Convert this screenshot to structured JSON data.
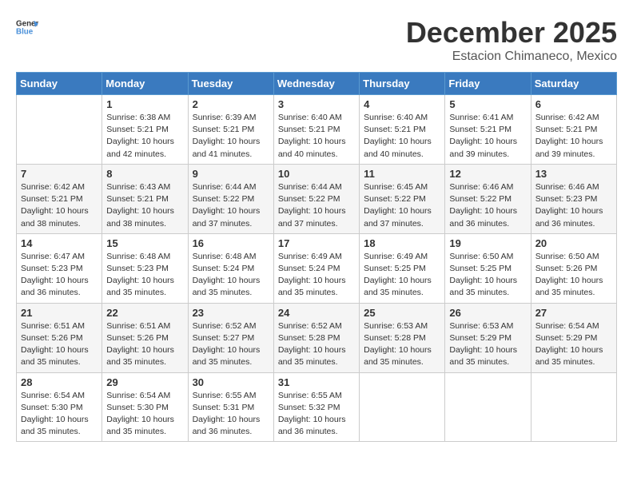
{
  "header": {
    "logo_general": "General",
    "logo_blue": "Blue",
    "month": "December 2025",
    "location": "Estacion Chimaneco, Mexico"
  },
  "weekdays": [
    "Sunday",
    "Monday",
    "Tuesday",
    "Wednesday",
    "Thursday",
    "Friday",
    "Saturday"
  ],
  "weeks": [
    [
      {
        "day": "",
        "info": ""
      },
      {
        "day": "1",
        "info": "Sunrise: 6:38 AM\nSunset: 5:21 PM\nDaylight: 10 hours\nand 42 minutes."
      },
      {
        "day": "2",
        "info": "Sunrise: 6:39 AM\nSunset: 5:21 PM\nDaylight: 10 hours\nand 41 minutes."
      },
      {
        "day": "3",
        "info": "Sunrise: 6:40 AM\nSunset: 5:21 PM\nDaylight: 10 hours\nand 40 minutes."
      },
      {
        "day": "4",
        "info": "Sunrise: 6:40 AM\nSunset: 5:21 PM\nDaylight: 10 hours\nand 40 minutes."
      },
      {
        "day": "5",
        "info": "Sunrise: 6:41 AM\nSunset: 5:21 PM\nDaylight: 10 hours\nand 39 minutes."
      },
      {
        "day": "6",
        "info": "Sunrise: 6:42 AM\nSunset: 5:21 PM\nDaylight: 10 hours\nand 39 minutes."
      }
    ],
    [
      {
        "day": "7",
        "info": "Sunrise: 6:42 AM\nSunset: 5:21 PM\nDaylight: 10 hours\nand 38 minutes."
      },
      {
        "day": "8",
        "info": "Sunrise: 6:43 AM\nSunset: 5:21 PM\nDaylight: 10 hours\nand 38 minutes."
      },
      {
        "day": "9",
        "info": "Sunrise: 6:44 AM\nSunset: 5:22 PM\nDaylight: 10 hours\nand 37 minutes."
      },
      {
        "day": "10",
        "info": "Sunrise: 6:44 AM\nSunset: 5:22 PM\nDaylight: 10 hours\nand 37 minutes."
      },
      {
        "day": "11",
        "info": "Sunrise: 6:45 AM\nSunset: 5:22 PM\nDaylight: 10 hours\nand 37 minutes."
      },
      {
        "day": "12",
        "info": "Sunrise: 6:46 AM\nSunset: 5:22 PM\nDaylight: 10 hours\nand 36 minutes."
      },
      {
        "day": "13",
        "info": "Sunrise: 6:46 AM\nSunset: 5:23 PM\nDaylight: 10 hours\nand 36 minutes."
      }
    ],
    [
      {
        "day": "14",
        "info": "Sunrise: 6:47 AM\nSunset: 5:23 PM\nDaylight: 10 hours\nand 36 minutes."
      },
      {
        "day": "15",
        "info": "Sunrise: 6:48 AM\nSunset: 5:23 PM\nDaylight: 10 hours\nand 35 minutes."
      },
      {
        "day": "16",
        "info": "Sunrise: 6:48 AM\nSunset: 5:24 PM\nDaylight: 10 hours\nand 35 minutes."
      },
      {
        "day": "17",
        "info": "Sunrise: 6:49 AM\nSunset: 5:24 PM\nDaylight: 10 hours\nand 35 minutes."
      },
      {
        "day": "18",
        "info": "Sunrise: 6:49 AM\nSunset: 5:25 PM\nDaylight: 10 hours\nand 35 minutes."
      },
      {
        "day": "19",
        "info": "Sunrise: 6:50 AM\nSunset: 5:25 PM\nDaylight: 10 hours\nand 35 minutes."
      },
      {
        "day": "20",
        "info": "Sunrise: 6:50 AM\nSunset: 5:26 PM\nDaylight: 10 hours\nand 35 minutes."
      }
    ],
    [
      {
        "day": "21",
        "info": "Sunrise: 6:51 AM\nSunset: 5:26 PM\nDaylight: 10 hours\nand 35 minutes."
      },
      {
        "day": "22",
        "info": "Sunrise: 6:51 AM\nSunset: 5:26 PM\nDaylight: 10 hours\nand 35 minutes."
      },
      {
        "day": "23",
        "info": "Sunrise: 6:52 AM\nSunset: 5:27 PM\nDaylight: 10 hours\nand 35 minutes."
      },
      {
        "day": "24",
        "info": "Sunrise: 6:52 AM\nSunset: 5:28 PM\nDaylight: 10 hours\nand 35 minutes."
      },
      {
        "day": "25",
        "info": "Sunrise: 6:53 AM\nSunset: 5:28 PM\nDaylight: 10 hours\nand 35 minutes."
      },
      {
        "day": "26",
        "info": "Sunrise: 6:53 AM\nSunset: 5:29 PM\nDaylight: 10 hours\nand 35 minutes."
      },
      {
        "day": "27",
        "info": "Sunrise: 6:54 AM\nSunset: 5:29 PM\nDaylight: 10 hours\nand 35 minutes."
      }
    ],
    [
      {
        "day": "28",
        "info": "Sunrise: 6:54 AM\nSunset: 5:30 PM\nDaylight: 10 hours\nand 35 minutes."
      },
      {
        "day": "29",
        "info": "Sunrise: 6:54 AM\nSunset: 5:30 PM\nDaylight: 10 hours\nand 35 minutes."
      },
      {
        "day": "30",
        "info": "Sunrise: 6:55 AM\nSunset: 5:31 PM\nDaylight: 10 hours\nand 36 minutes."
      },
      {
        "day": "31",
        "info": "Sunrise: 6:55 AM\nSunset: 5:32 PM\nDaylight: 10 hours\nand 36 minutes."
      },
      {
        "day": "",
        "info": ""
      },
      {
        "day": "",
        "info": ""
      },
      {
        "day": "",
        "info": ""
      }
    ]
  ]
}
